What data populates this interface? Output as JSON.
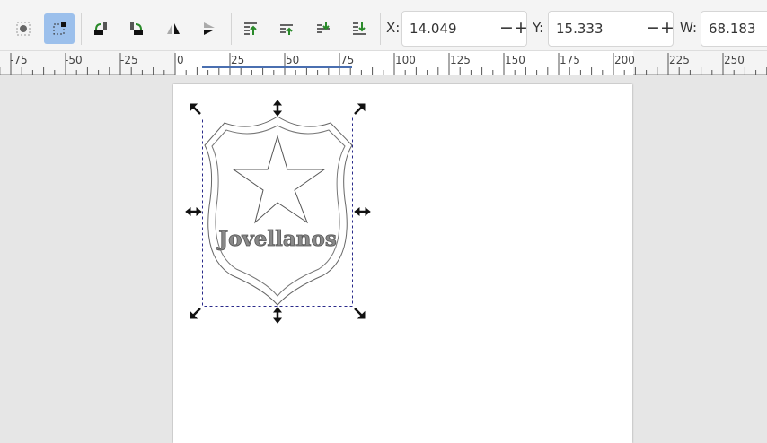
{
  "toolbar": {
    "buttons": [
      "select-all-icon",
      "touch-select-icon",
      "rotate-ccw-icon",
      "rotate-cw-icon",
      "flip-horizontal-icon",
      "flip-vertical-icon",
      "raise-to-top-icon",
      "raise-icon",
      "lower-icon",
      "lower-to-bottom-icon"
    ],
    "x_label": "X:",
    "x_value": "14.049",
    "y_label": "Y:",
    "y_value": "15.333",
    "w_label": "W:",
    "w_value": "68.183",
    "minus": "−",
    "plus": "+"
  },
  "ruler": {
    "labels": [
      "-75",
      "-50",
      "-25",
      "0",
      "25",
      "50",
      "75",
      "100",
      "125",
      "150",
      "175",
      "200",
      "225",
      "250"
    ]
  },
  "drawing": {
    "text": "Jovellanos"
  },
  "colors": {
    "accent": "#9cc0ec",
    "selection": "#2a2a8a"
  }
}
